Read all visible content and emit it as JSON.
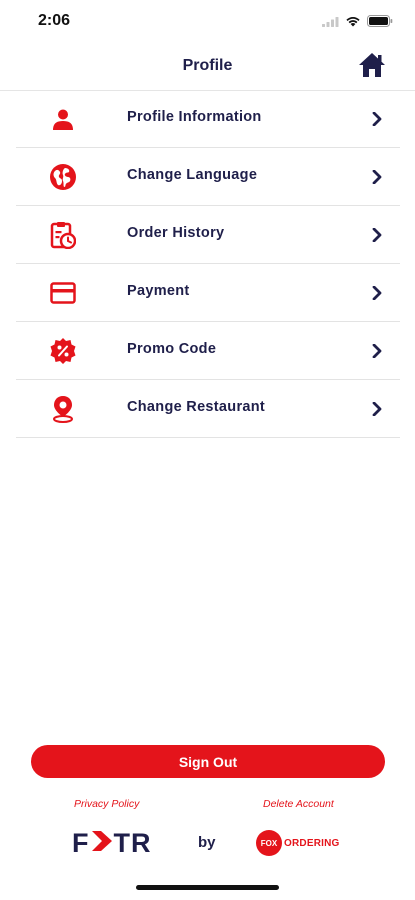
{
  "status_bar": {
    "time": "2:06"
  },
  "header": {
    "title": "Profile",
    "home_icon": "home-icon"
  },
  "menu": {
    "items": [
      {
        "label": "Profile Information",
        "icon": "person-icon"
      },
      {
        "label": "Change Language",
        "icon": "globe-icon"
      },
      {
        "label": "Order History",
        "icon": "clipboard-clock-icon"
      },
      {
        "label": "Payment",
        "icon": "credit-card-icon"
      },
      {
        "label": "Promo Code",
        "icon": "discount-badge-icon"
      },
      {
        "label": "Change Restaurant",
        "icon": "location-pin-icon"
      }
    ]
  },
  "footer": {
    "sign_out_label": "Sign Out",
    "privacy_label": "Privacy Policy",
    "delete_label": "Delete Account",
    "brand_left_f": "F",
    "brand_left_tr": "TR",
    "by_label": "by",
    "fox_badge": "FOX",
    "fox_text": "ORDERING"
  },
  "colors": {
    "accent": "#e4141b",
    "navy": "#1f1f4a",
    "background": "#ffffff"
  }
}
